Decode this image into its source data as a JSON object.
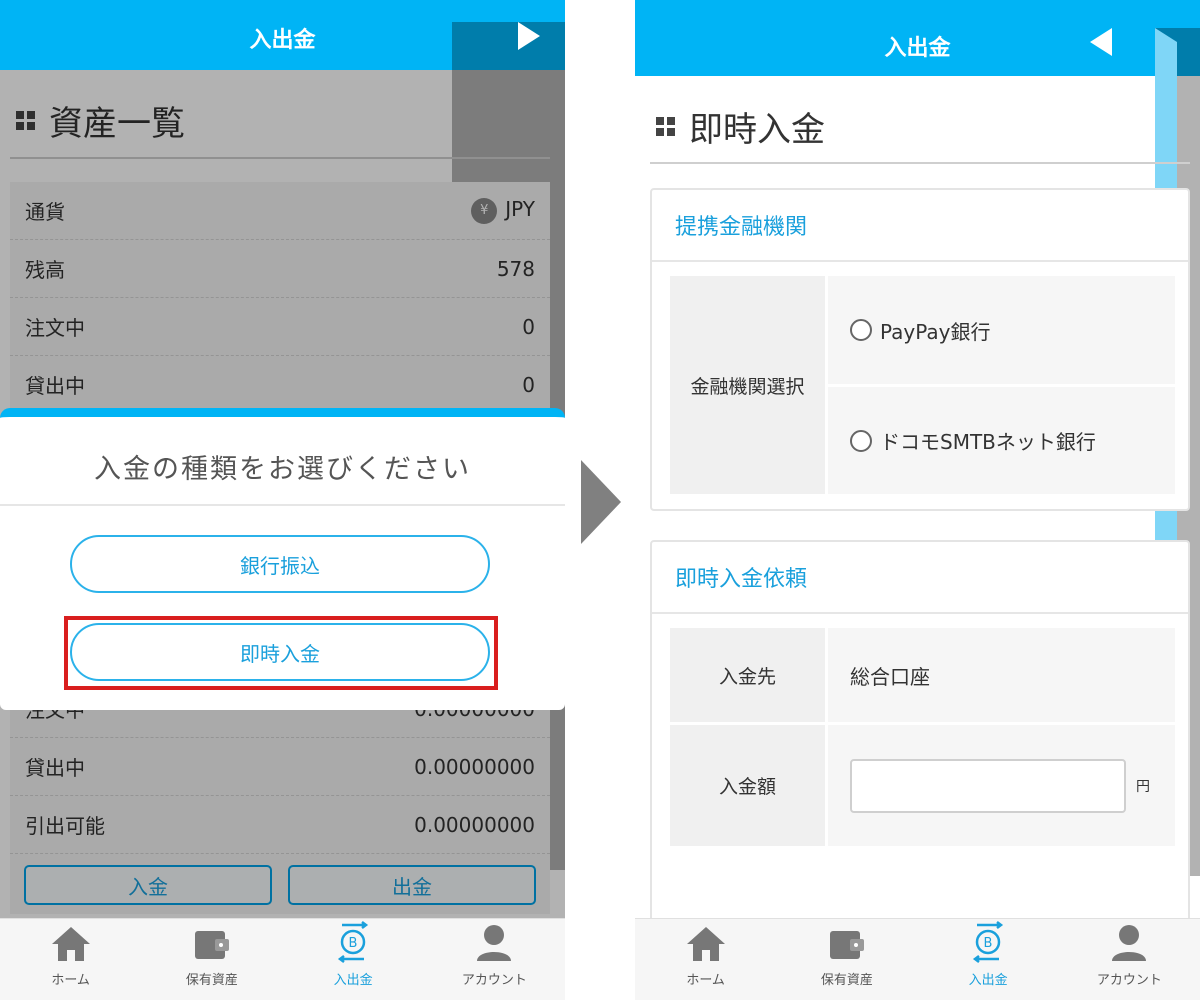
{
  "left": {
    "header": {
      "title": "入出金"
    },
    "page_title": "資産一覧",
    "assets_top": [
      {
        "label": "通貨",
        "value": "JPY"
      },
      {
        "label": "残高",
        "value": "578"
      },
      {
        "label": "注文中",
        "value": "0"
      },
      {
        "label": "貸出中",
        "value": "0"
      }
    ],
    "yen_symbol": "¥",
    "assets_bottom": [
      {
        "label": "注文中",
        "value": "0.00000000"
      },
      {
        "label": "貸出中",
        "value": "0.00000000"
      },
      {
        "label": "引出可能",
        "value": "0.00000000"
      }
    ],
    "deposit_label": "入金",
    "withdraw_label": "出金",
    "modal": {
      "title": "入金の種類をお選びください",
      "bank_transfer": "銀行振込",
      "instant_deposit": "即時入金"
    }
  },
  "right": {
    "header": {
      "title": "入出金"
    },
    "page_title": "即時入金",
    "partner_section": {
      "heading": "提携金融機関",
      "label": "金融機関選択",
      "options": [
        "PayPay銀行",
        "ドコモSMTBネット銀行"
      ]
    },
    "request_section": {
      "heading": "即時入金依頼",
      "destination_label": "入金先",
      "destination_value": "総合口座",
      "amount_label": "入金額",
      "amount_value": "",
      "amount_unit": "円"
    }
  },
  "tabs": [
    "ホーム",
    "保有資産",
    "入出金",
    "アカウント"
  ],
  "active_tab": "入出金",
  "colors": {
    "brand": "#00b4f5",
    "accent_text": "#1aa0dc",
    "highlight": "#d91e1e"
  }
}
